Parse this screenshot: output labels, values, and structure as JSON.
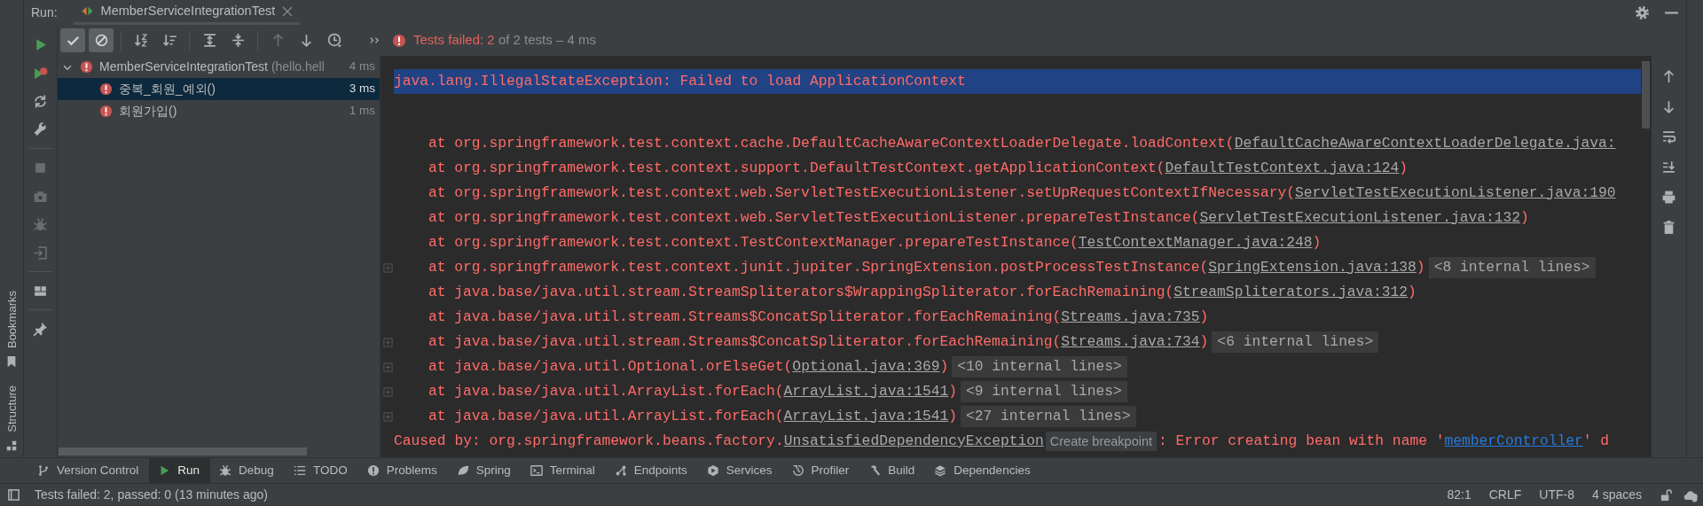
{
  "run_panel": {
    "title": "Run:",
    "tabs": [
      {
        "label": "MemberServiceIntegrationTest",
        "selected": true
      }
    ]
  },
  "side_toolbar": [
    {
      "kind": "play",
      "disabled": false
    },
    {
      "kind": "play-error",
      "disabled": false
    },
    {
      "kind": "refresh",
      "disabled": false
    },
    {
      "kind": "wrench",
      "disabled": false
    },
    {
      "kind": "stop",
      "disabled": true
    },
    {
      "kind": "camera",
      "disabled": true
    },
    {
      "kind": "bug",
      "disabled": true
    },
    {
      "kind": "import",
      "disabled": true
    },
    {
      "kind": "layout",
      "disabled": false
    },
    {
      "kind": "pin",
      "disabled": false
    }
  ],
  "test_toolbar": [
    {
      "kind": "check",
      "on": true,
      "disabled": false
    },
    {
      "kind": "cancel",
      "on": true,
      "disabled": false
    },
    {
      "kind": "sort",
      "on": false,
      "disabled": false
    },
    {
      "kind": "sort-bars",
      "on": false,
      "disabled": false
    },
    {
      "kind": "expand",
      "on": false,
      "disabled": false
    },
    {
      "kind": "collapse",
      "on": false,
      "disabled": false
    },
    {
      "kind": "arrow-up",
      "on": false,
      "disabled": true
    },
    {
      "kind": "arrow-down",
      "on": false,
      "disabled": false
    },
    {
      "kind": "history",
      "on": false,
      "disabled": false
    }
  ],
  "summary": {
    "failed_state": true,
    "failed": "Tests failed: 2",
    "detail": "of 2 tests – 4 ms"
  },
  "tree": [
    {
      "label": "MemberServiceIntegrationTest",
      "package": "(hello.hell",
      "time": "4 ms",
      "failed": true,
      "expanded": true,
      "selected": false,
      "children": [
        {
          "label": "중복_회원_예외()",
          "time": "3 ms",
          "failed": true,
          "selected": true
        },
        {
          "label": "회원가입()",
          "time": "1 ms",
          "failed": true,
          "selected": false
        }
      ]
    }
  ],
  "console": {
    "lines": [
      {
        "kind": "exception",
        "selected": true,
        "foldable": false,
        "parts": [
          {
            "kind": "text",
            "text": "java.lang.IllegalStateException: Failed to load ApplicationContext"
          }
        ]
      },
      {
        "kind": "frame",
        "selected": false,
        "foldable": false,
        "parts": [
          {
            "kind": "text",
            "text": "at org.springframework.test.context.cache.DefaultCacheAwareContextLoaderDelegate.loadContext("
          },
          {
            "kind": "link",
            "text": "DefaultCacheAwareContextLoaderDelegate.java:"
          }
        ]
      },
      {
        "kind": "frame",
        "selected": false,
        "foldable": false,
        "parts": [
          {
            "kind": "text",
            "text": "at org.springframework.test.context.support.DefaultTestContext.getApplicationContext("
          },
          {
            "kind": "link",
            "text": "DefaultTestContext.java:124"
          },
          {
            "kind": "text",
            "text": ")"
          }
        ]
      },
      {
        "kind": "frame",
        "selected": false,
        "foldable": false,
        "parts": [
          {
            "kind": "text",
            "text": "at org.springframework.test.context.web.ServletTestExecutionListener.setUpRequestContextIfNecessary("
          },
          {
            "kind": "link",
            "text": "ServletTestExecutionListener.java:190"
          }
        ]
      },
      {
        "kind": "frame",
        "selected": false,
        "foldable": false,
        "parts": [
          {
            "kind": "text",
            "text": "at org.springframework.test.context.web.ServletTestExecutionListener.prepareTestInstance("
          },
          {
            "kind": "link",
            "text": "ServletTestExecutionListener.java:132"
          },
          {
            "kind": "text",
            "text": ")"
          }
        ]
      },
      {
        "kind": "frame",
        "selected": false,
        "foldable": false,
        "parts": [
          {
            "kind": "text",
            "text": "at org.springframework.test.context.TestContextManager.prepareTestInstance("
          },
          {
            "kind": "link",
            "text": "TestContextManager.java:248"
          },
          {
            "kind": "text",
            "text": ")"
          }
        ]
      },
      {
        "kind": "frame",
        "selected": false,
        "foldable": true,
        "parts": [
          {
            "kind": "text",
            "text": "at org.springframework.test.context.junit.jupiter.SpringExtension.postProcessTestInstance("
          },
          {
            "kind": "link",
            "text": "SpringExtension.java:138"
          },
          {
            "kind": "text",
            "text": ")"
          },
          {
            "kind": "fold",
            "text": "<8 internal lines>"
          }
        ]
      },
      {
        "kind": "frame",
        "selected": false,
        "foldable": false,
        "parts": [
          {
            "kind": "text",
            "text": "at java.base/java.util.stream.StreamSpliterators$WrappingSpliterator.forEachRemaining("
          },
          {
            "kind": "link",
            "text": "StreamSpliterators.java:312"
          },
          {
            "kind": "text",
            "text": ")"
          }
        ]
      },
      {
        "kind": "frame",
        "selected": false,
        "foldable": false,
        "parts": [
          {
            "kind": "text",
            "text": "at java.base/java.util.stream.Streams$ConcatSpliterator.forEachRemaining("
          },
          {
            "kind": "link",
            "text": "Streams.java:735"
          },
          {
            "kind": "text",
            "text": ")"
          }
        ]
      },
      {
        "kind": "frame",
        "selected": false,
        "foldable": true,
        "parts": [
          {
            "kind": "text",
            "text": "at java.base/java.util.stream.Streams$ConcatSpliterator.forEachRemaining("
          },
          {
            "kind": "link",
            "text": "Streams.java:734"
          },
          {
            "kind": "text",
            "text": ")"
          },
          {
            "kind": "fold",
            "text": "<6 internal lines>"
          }
        ]
      },
      {
        "kind": "frame",
        "selected": false,
        "foldable": true,
        "parts": [
          {
            "kind": "text",
            "text": "at java.base/java.util.Optional.orElseGet("
          },
          {
            "kind": "link",
            "text": "Optional.java:369"
          },
          {
            "kind": "text",
            "text": ")"
          },
          {
            "kind": "fold",
            "text": "<10 internal lines>"
          }
        ]
      },
      {
        "kind": "frame",
        "selected": false,
        "foldable": true,
        "parts": [
          {
            "kind": "text",
            "text": "at java.base/java.util.ArrayList.forEach("
          },
          {
            "kind": "link",
            "text": "ArrayList.java:1541"
          },
          {
            "kind": "text",
            "text": ")"
          },
          {
            "kind": "fold",
            "text": "<9 internal lines>"
          }
        ]
      },
      {
        "kind": "frame",
        "selected": false,
        "foldable": true,
        "parts": [
          {
            "kind": "text",
            "text": "at java.base/java.util.ArrayList.forEach("
          },
          {
            "kind": "link",
            "text": "ArrayList.java:1541"
          },
          {
            "kind": "text",
            "text": ")"
          },
          {
            "kind": "fold",
            "text": "<27 internal lines>"
          }
        ]
      },
      {
        "kind": "cause",
        "selected": false,
        "foldable": false,
        "parts": [
          {
            "kind": "text",
            "text": "Caused by: org.springframework.beans.factory."
          },
          {
            "kind": "link",
            "text": "UnsatisfiedDependencyException"
          },
          {
            "kind": "hint",
            "text": "Create breakpoint"
          },
          {
            "kind": "text",
            "text": ": Error creating bean with name '"
          },
          {
            "kind": "ref",
            "text": "memberController"
          },
          {
            "kind": "text",
            "text": "' d"
          }
        ]
      }
    ]
  },
  "console_toolbar": [
    {
      "kind": "arrow-up"
    },
    {
      "kind": "arrow-down"
    },
    {
      "kind": "wrap"
    },
    {
      "kind": "scroll-end"
    },
    {
      "kind": "print"
    },
    {
      "kind": "trash"
    }
  ],
  "left_stripe": [
    {
      "label": "Bookmarks"
    },
    {
      "label": "Structure"
    }
  ],
  "tool_tabs": [
    {
      "label": "Version Control",
      "selected": false
    },
    {
      "label": "Run",
      "selected": true
    },
    {
      "label": "Debug",
      "selected": false
    },
    {
      "label": "TODO",
      "selected": false
    },
    {
      "label": "Problems",
      "selected": false
    },
    {
      "label": "Spring",
      "selected": false
    },
    {
      "label": "Terminal",
      "selected": false
    },
    {
      "label": "Endpoints",
      "selected": false
    },
    {
      "label": "Services",
      "selected": false
    },
    {
      "label": "Profiler",
      "selected": false
    },
    {
      "label": "Build",
      "selected": false
    },
    {
      "label": "Dependencies",
      "selected": false
    }
  ],
  "status_bar": {
    "message": "Tests failed: 2, passed: 0 (13 minutes ago)",
    "items": [
      "82:1",
      "CRLF",
      "UTF-8",
      "4 spaces"
    ]
  }
}
